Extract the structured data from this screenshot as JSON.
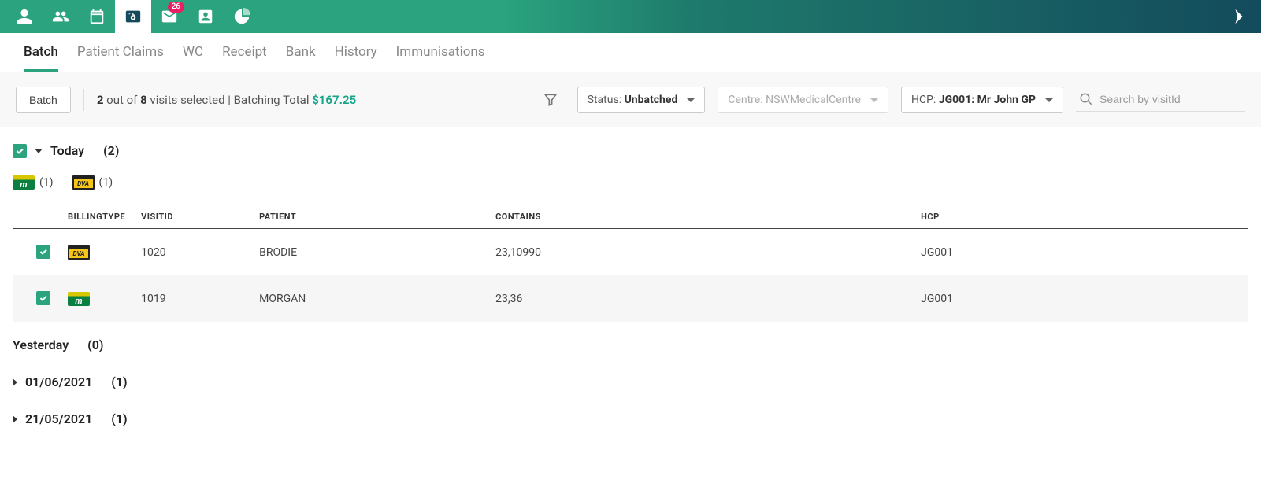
{
  "topbar": {
    "badge_count": "26"
  },
  "tabs": [
    {
      "label": "Batch",
      "active": true
    },
    {
      "label": "Patient Claims"
    },
    {
      "label": "WC"
    },
    {
      "label": "Receipt"
    },
    {
      "label": "Bank"
    },
    {
      "label": "History"
    },
    {
      "label": "Immunisations"
    }
  ],
  "toolbar": {
    "batch_btn": "Batch",
    "summary": {
      "selected": "2",
      "mid1": " out of ",
      "total_visits": "8",
      "mid2": " visits selected | Batching Total ",
      "total_amount": "$167.25"
    },
    "status": {
      "label": "Status: ",
      "value": "Unbatched"
    },
    "centre": {
      "label": "Centre: ",
      "value": "NSWMedicalCentre"
    },
    "hcp": {
      "label": "HCP: ",
      "value": "JG001: Mr John GP"
    },
    "search_placeholder": "Search by visitId"
  },
  "groups": {
    "today": {
      "label": "Today",
      "count": "(2)"
    },
    "type_counts": {
      "medicare": {
        "glyph": "m",
        "count": "(1)"
      },
      "dva": {
        "glyph": "DVA",
        "count": "(1)"
      }
    },
    "headers": {
      "billing": "BILLINGTYPE",
      "visit": "VISITID",
      "patient": "PATIENT",
      "contains": "CONTAINS",
      "hcp": "HCP"
    },
    "rows": [
      {
        "type": "dva",
        "visit": "1020",
        "patient": "BRODIE",
        "contains": "23,10990",
        "hcp": "JG001"
      },
      {
        "type": "medicare",
        "visit": "1019",
        "patient": "MORGAN",
        "contains": "23,36",
        "hcp": "JG001"
      }
    ],
    "yesterday": {
      "label": "Yesterday",
      "count": "(0)"
    },
    "g3": {
      "label": "01/06/2021",
      "count": "(1)"
    },
    "g4": {
      "label": "21/05/2021",
      "count": "(1)"
    }
  }
}
